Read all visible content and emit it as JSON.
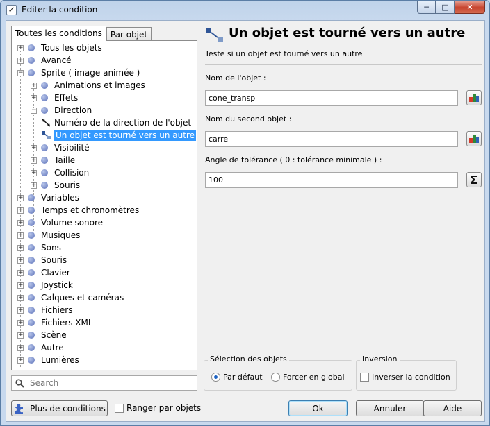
{
  "window": {
    "title": "Editer la condition",
    "minimize_glyph": "─",
    "maximize_glyph": "□",
    "close_glyph": "✕"
  },
  "tabs": [
    {
      "label": "Toutes les conditions",
      "active": true
    },
    {
      "label": "Par objet",
      "active": false
    }
  ],
  "tree": {
    "items": [
      {
        "label": "Tous les objets",
        "expander": "+"
      },
      {
        "label": "Avancé",
        "expander": "+"
      },
      {
        "label": "Sprite ( image animée )",
        "expander": "−"
      },
      {
        "label": "Animations et images",
        "expander": "+"
      },
      {
        "label": "Effets",
        "expander": "+"
      },
      {
        "label": "Direction",
        "expander": "−"
      },
      {
        "label": "Numéro de la direction de l'objet"
      },
      {
        "label": "Un objet est tourné vers un autre",
        "selected": true
      },
      {
        "label": "Visibilité",
        "expander": "+"
      },
      {
        "label": "Taille",
        "expander": "+"
      },
      {
        "label": "Collision",
        "expander": "+"
      },
      {
        "label": "Souris",
        "expander": "+"
      },
      {
        "label": "Variables",
        "expander": "+"
      },
      {
        "label": "Temps et chronomètres",
        "expander": "+"
      },
      {
        "label": "Volume sonore",
        "expander": "+"
      },
      {
        "label": "Musiques",
        "expander": "+"
      },
      {
        "label": "Sons",
        "expander": "+"
      },
      {
        "label": "Souris",
        "expander": "+"
      },
      {
        "label": "Clavier",
        "expander": "+"
      },
      {
        "label": "Joystick",
        "expander": "+"
      },
      {
        "label": "Calques et caméras",
        "expander": "+"
      },
      {
        "label": "Fichiers",
        "expander": "+"
      },
      {
        "label": "Fichiers XML",
        "expander": "+"
      },
      {
        "label": "Scène",
        "expander": "+"
      },
      {
        "label": "Autre",
        "expander": "+"
      },
      {
        "label": "Lumières",
        "expander": "+"
      }
    ]
  },
  "search": {
    "placeholder": "Search"
  },
  "condition": {
    "title": "Un objet est tourné vers un autre",
    "description": "Teste si un objet est tourné vers un autre",
    "fields": [
      {
        "label": "Nom de l'objet :",
        "value": "cone_transp",
        "button": "object-picker-icon"
      },
      {
        "label": "Nom du second objet :",
        "value": "carre",
        "button": "object-picker-icon"
      },
      {
        "label": "Angle de tolérance ( 0 : tolérance minimale ) :",
        "value": "100",
        "button": "sigma-icon"
      }
    ]
  },
  "selection_group": {
    "title": "Sélection des objets",
    "options": [
      "Par défaut",
      "Forcer en global"
    ],
    "selected": "Par défaut"
  },
  "inversion_group": {
    "title": "Inversion",
    "checkbox_label": "Inverser la condition",
    "checked": false
  },
  "bottom": {
    "more_button": "Plus de conditions",
    "sort_checkbox": "Ranger par objets",
    "ok": "Ok",
    "cancel": "Annuler",
    "help": "Aide"
  },
  "colors": {
    "selection": "#3399ff",
    "accent": "#1e63c2"
  }
}
